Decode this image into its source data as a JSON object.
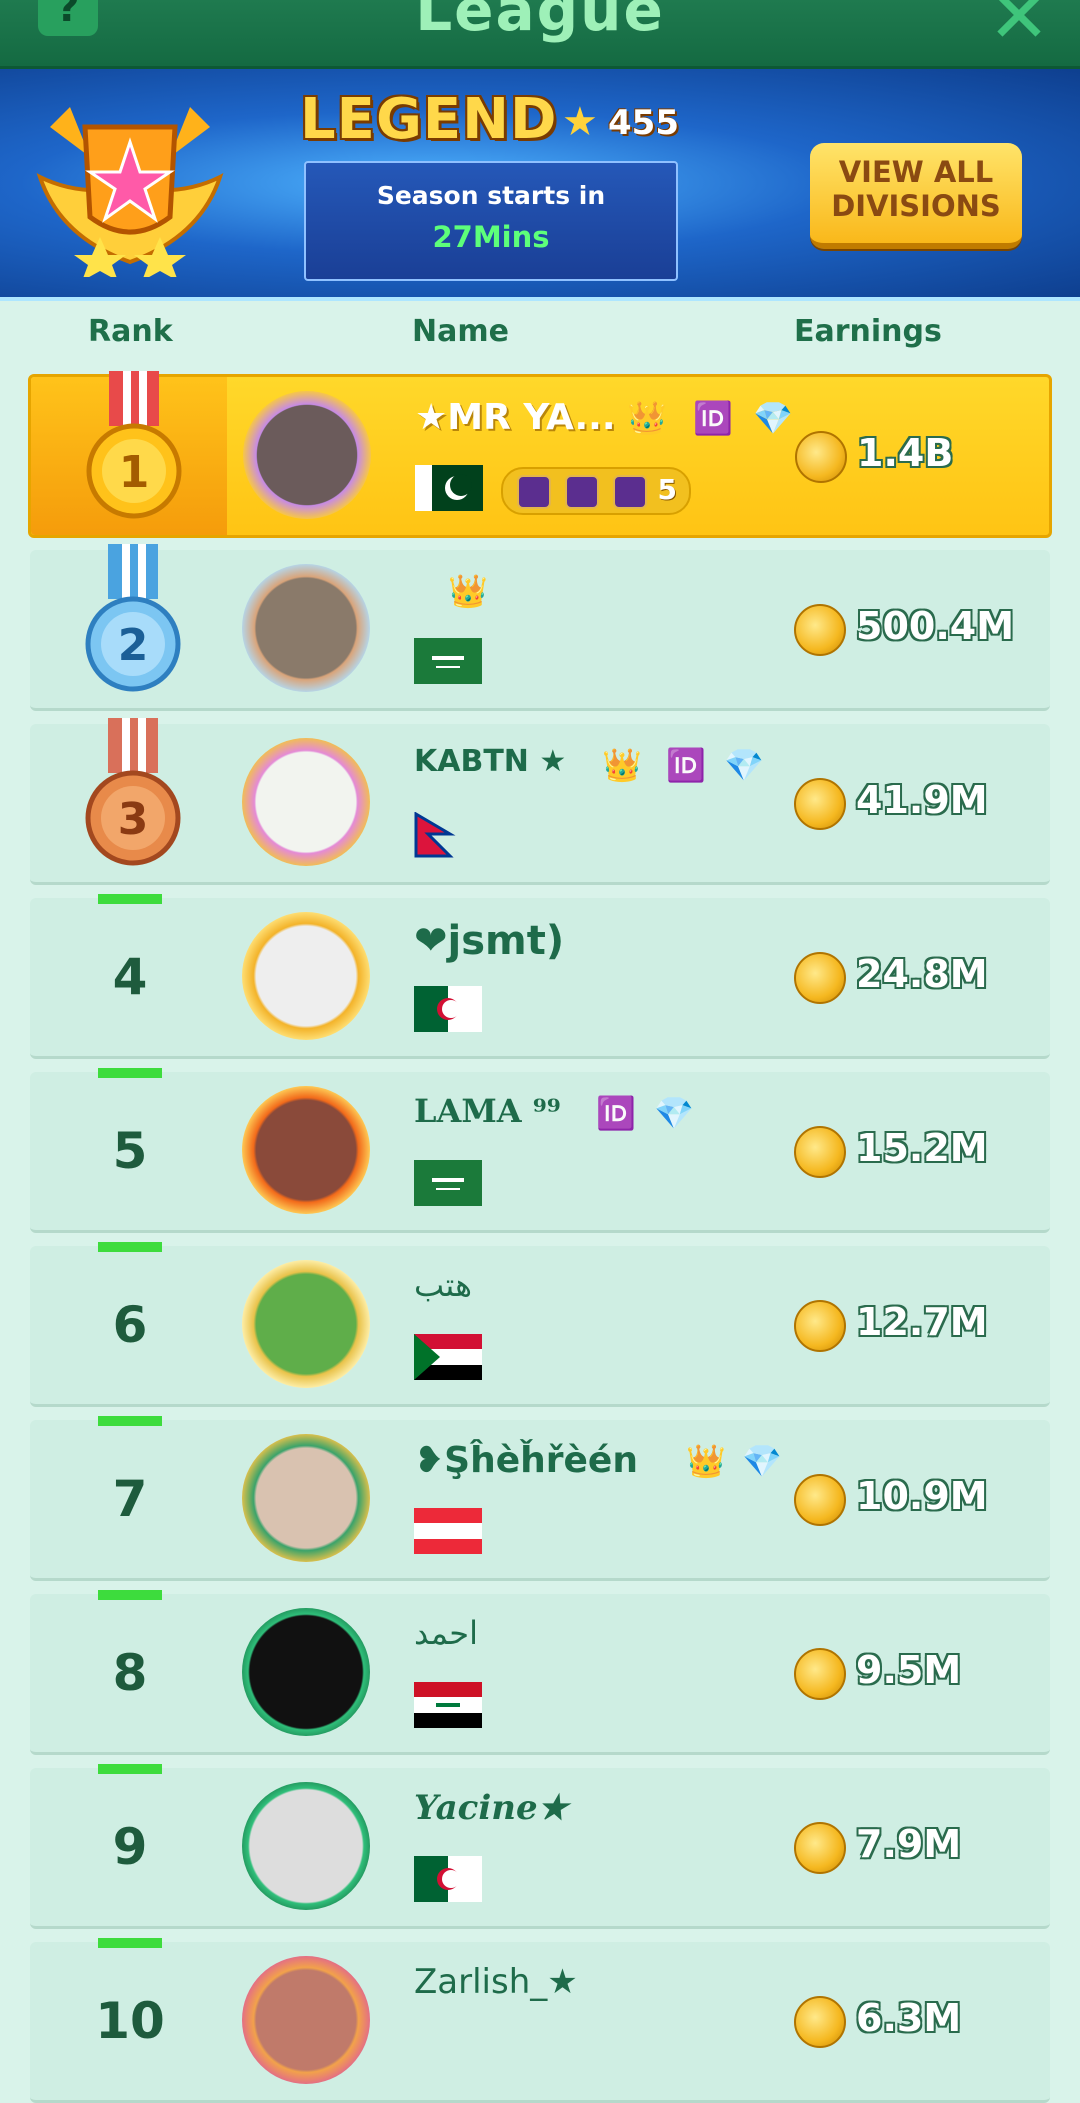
{
  "header": {
    "title": "League"
  },
  "banner": {
    "division": "LEGEND",
    "score": "455",
    "season_label": "Season starts in",
    "season_time": "27Mins",
    "view_all": "VIEW ALL DIVISIONS"
  },
  "columns": {
    "rank": "Rank",
    "name": "Name",
    "earnings": "Earnings"
  },
  "rows": [
    {
      "rank": "1",
      "name": "★MR YA...",
      "earnings": "1.4B",
      "titles_count": "5"
    },
    {
      "rank": "2",
      "name": "",
      "earnings": "500.4M"
    },
    {
      "rank": "3",
      "name": "KABTN ★",
      "earnings": "41.9M"
    },
    {
      "rank": "4",
      "name": "❤jsmt)",
      "earnings": "24.8M"
    },
    {
      "rank": "5",
      "name": "LAMA ⁹⁹",
      "earnings": "15.2M"
    },
    {
      "rank": "6",
      "name": "هتب",
      "earnings": "12.7M"
    },
    {
      "rank": "7",
      "name": "❥Şĥèȟřèén",
      "earnings": "10.9M"
    },
    {
      "rank": "8",
      "name": "احمد",
      "earnings": "9.5M"
    },
    {
      "rank": "9",
      "name": "Yacine★",
      "earnings": "7.9M"
    },
    {
      "rank": "10",
      "name": "Zarlish_★",
      "earnings": "6.3M"
    }
  ],
  "colors": {
    "accent_green": "#1e6b4a",
    "gold": "#ffc414",
    "rank_marker": "#3ddc3d"
  }
}
